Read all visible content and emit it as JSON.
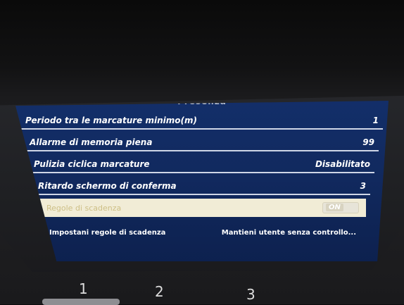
{
  "screen": {
    "title": "Presenza",
    "rows": [
      {
        "label": "Periodo tra le marcature minimo(m)",
        "value": "1"
      },
      {
        "label": "Allarme di memoria piena",
        "value": "99"
      },
      {
        "label": "Pulizia ciclica marcature",
        "value": "Disabilitato"
      },
      {
        "label": "Ritardo schermo di conferma",
        "value": "3"
      },
      {
        "label": "Regole di scadenza",
        "toggle": "ON",
        "selected": true
      },
      {
        "label": "Impostani regole di scadenza",
        "value": "Mantieni utente senza controllo..."
      }
    ]
  },
  "keypad": {
    "keys": [
      "1",
      "2",
      "3"
    ]
  },
  "colors": {
    "screen_bg": "#132f6a",
    "row_line": "#cfd6e6",
    "highlight_bg": "#f1ecd6",
    "highlight_text": "#cdbf86"
  }
}
